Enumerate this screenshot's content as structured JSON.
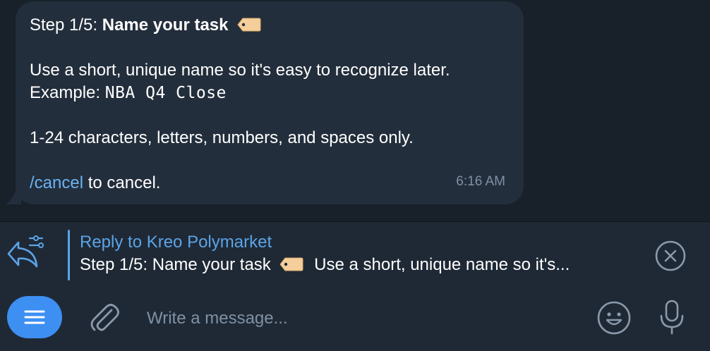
{
  "message": {
    "step_prefix": "Step 1/5: ",
    "step_title": "Name your task",
    "tag_emoji": "label-tag-icon",
    "instruction": "Use a short, unique name so it's easy to recognize later.",
    "example_label": "Example: ",
    "example_value": "NBA Q4 Close",
    "rules": "1-24 characters, letters, numbers, and spaces only.",
    "cancel_command": "/cancel",
    "cancel_suffix": " to cancel.",
    "time": "6:16 AM"
  },
  "reply": {
    "title": "Reply to Kreo Polymarket",
    "preview_prefix": "Step 1/5: Name your task",
    "preview_suffix": "Use a short, unique name so it's..."
  },
  "composer": {
    "placeholder": "Write a message..."
  },
  "colors": {
    "accent": "#6ab3f3",
    "bubble": "#232e3c",
    "menu_button": "#3d8ff2"
  }
}
